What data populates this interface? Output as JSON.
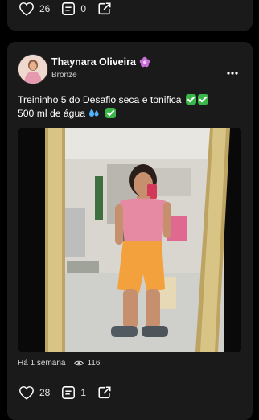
{
  "prev_post": {
    "likes": "26",
    "comments": "0"
  },
  "post": {
    "author": "Thaynara Oliveira",
    "rank": "Bronze",
    "text_line1": "Treininho 5 do Desafio seca e tonifica",
    "text_line2": "500 ml de água",
    "time": "Há 1 semana",
    "views": "116",
    "likes": "28",
    "comments": "1"
  },
  "icons": {
    "like": "heart-icon",
    "comment": "comment-icon",
    "share": "share-icon",
    "more": "more-options-icon",
    "views": "eye-icon",
    "badge": "flower-badge-icon"
  },
  "colors": {
    "background": "#000000",
    "card": "#1a1a1a",
    "badge": "#c86fd8",
    "check": "#39b54a"
  }
}
